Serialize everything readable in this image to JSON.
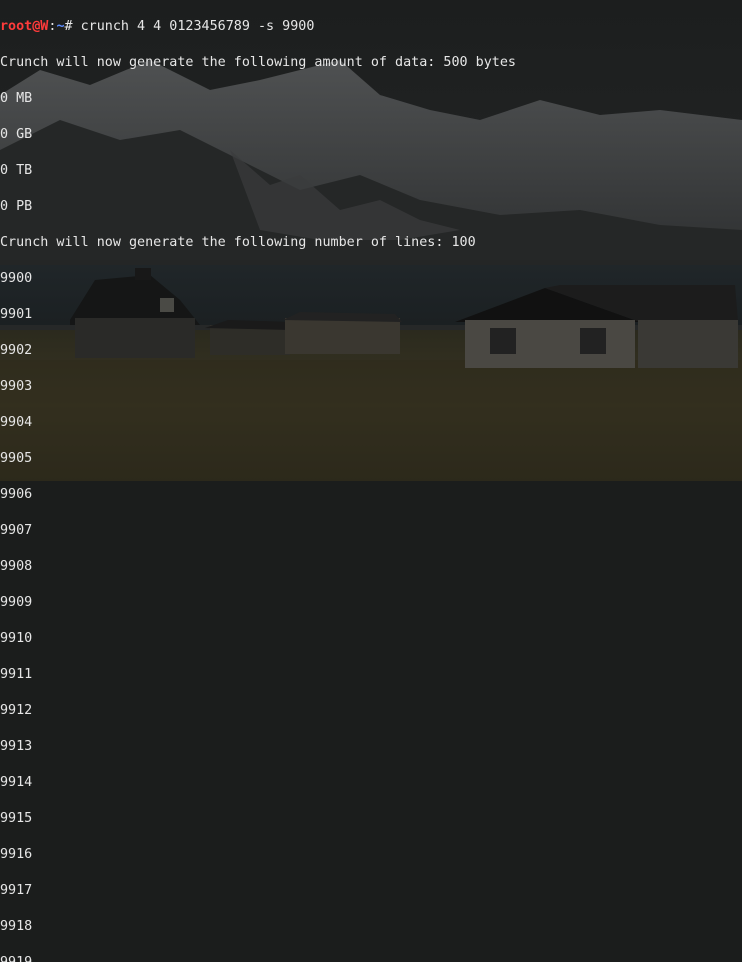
{
  "prompt": {
    "user_host": "root@W",
    "separator": ":",
    "path": "~",
    "symbol": "#",
    "command": "crunch 4 4 0123456789 -s 9900"
  },
  "output_lines": [
    "Crunch will now generate the following amount of data: 500 bytes",
    "0 MB",
    "0 GB",
    "0 TB",
    "0 PB",
    "Crunch will now generate the following number of lines: 100",
    "9900",
    "9901",
    "9902",
    "9903",
    "9904",
    "9905",
    "9906",
    "9907",
    "9908",
    "9909",
    "9910",
    "9911",
    "9912",
    "9913",
    "9914",
    "9915",
    "9916",
    "9917",
    "9918",
    "9919"
  ],
  "colors": {
    "user_host": "#ff3b3b",
    "path": "#5c8cff",
    "text": "#e6e6e6"
  }
}
